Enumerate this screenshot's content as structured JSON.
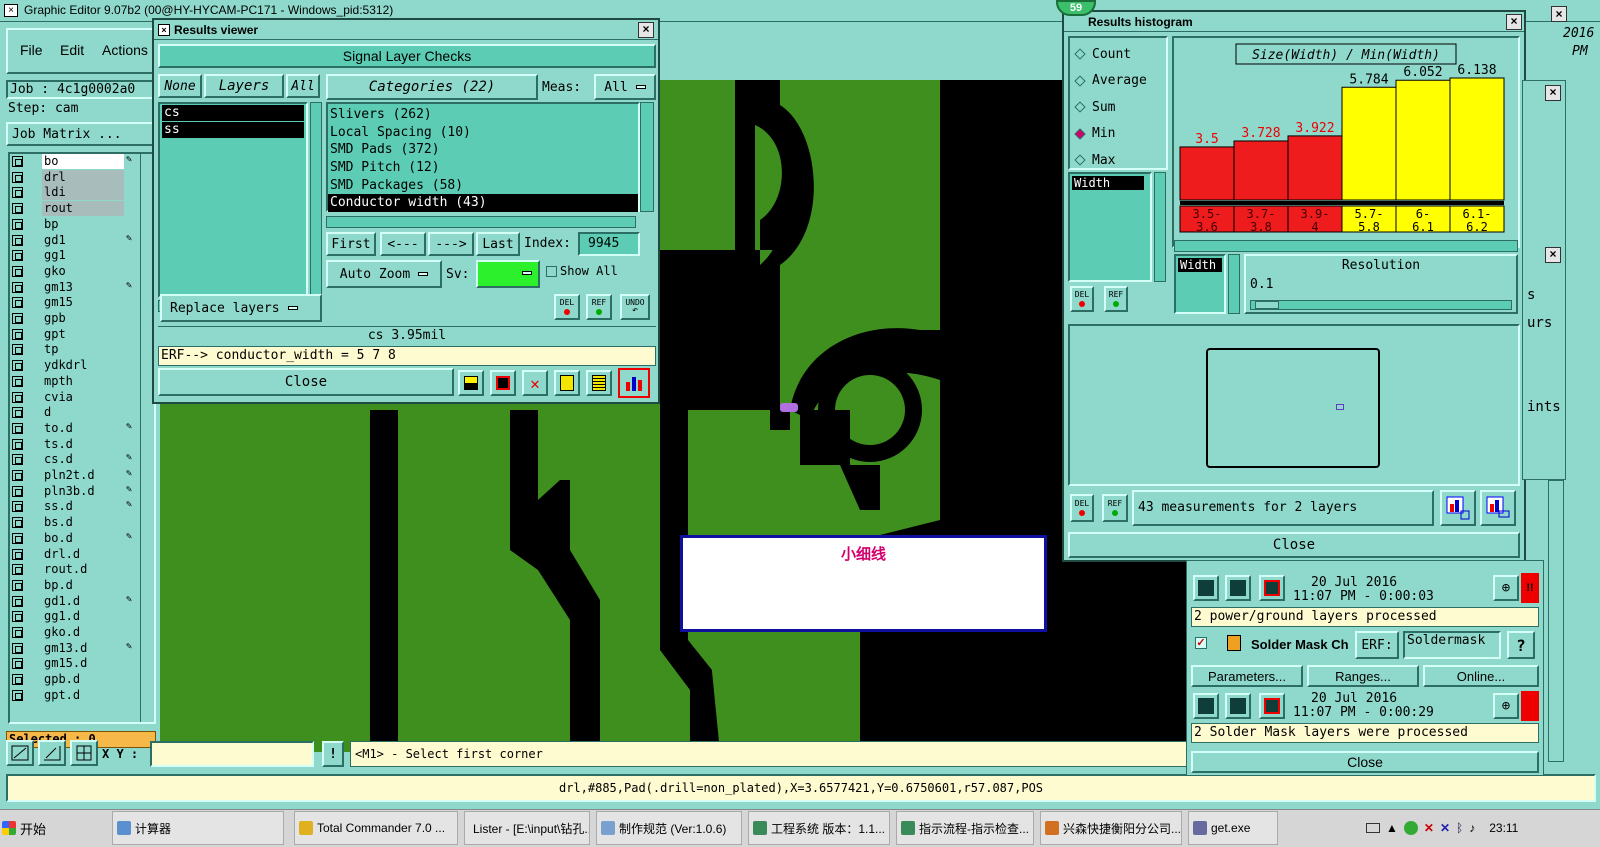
{
  "app": {
    "title": "Graphic Editor 9.07b2 (00@HY-HYCAM-PC171 - Windows_pid:5312)",
    "menu": [
      "File",
      "Edit",
      "Actions"
    ],
    "job": "Job : 4c1g0002a0",
    "step": "Step: cam",
    "job_matrix": "Job Matrix ...",
    "selected": "Selected : 0",
    "xy_label": "X Y :",
    "xy_value": "",
    "excl": "!",
    "prompt": "<M1> - Select first corner",
    "status": "drl,#885,Pad(.drill=non_plated),X=3.6577421,Y=0.6750601,r57.087,POS",
    "clock_top": "2016",
    "clock_pm": "PM",
    "layers": [
      {
        "name": "bo",
        "edit": true,
        "style": "white"
      },
      {
        "name": "drl",
        "edit": false,
        "style": "grey"
      },
      {
        "name": "ldi",
        "edit": false,
        "style": "grey"
      },
      {
        "name": "rout",
        "edit": false,
        "style": "grey"
      },
      {
        "name": "bp",
        "edit": false,
        "style": "plain"
      },
      {
        "name": "gd1",
        "edit": true,
        "style": "plain"
      },
      {
        "name": "gg1",
        "edit": false,
        "style": "plain"
      },
      {
        "name": "gko",
        "edit": false,
        "style": "plain"
      },
      {
        "name": "gm13",
        "edit": true,
        "style": "plain"
      },
      {
        "name": "gm15",
        "edit": false,
        "style": "plain"
      },
      {
        "name": "gpb",
        "edit": false,
        "style": "plain"
      },
      {
        "name": "gpt",
        "edit": false,
        "style": "plain"
      },
      {
        "name": "tp",
        "edit": false,
        "style": "plain"
      },
      {
        "name": "ydkdrl",
        "edit": false,
        "style": "plain"
      },
      {
        "name": "mpth",
        "edit": false,
        "style": "plain"
      },
      {
        "name": "cvia",
        "edit": false,
        "style": "plain"
      },
      {
        "name": "d",
        "edit": false,
        "style": "plain"
      },
      {
        "name": "to.d",
        "edit": true,
        "style": "plain"
      },
      {
        "name": "ts.d",
        "edit": false,
        "style": "plain"
      },
      {
        "name": "cs.d",
        "edit": true,
        "style": "plain"
      },
      {
        "name": "pln2t.d",
        "edit": true,
        "style": "plain"
      },
      {
        "name": "pln3b.d",
        "edit": true,
        "style": "plain"
      },
      {
        "name": "ss.d",
        "edit": true,
        "style": "plain"
      },
      {
        "name": "bs.d",
        "edit": false,
        "style": "plain"
      },
      {
        "name": "bo.d",
        "edit": true,
        "style": "plain"
      },
      {
        "name": "drl.d",
        "edit": false,
        "style": "plain"
      },
      {
        "name": "rout.d",
        "edit": false,
        "style": "plain"
      },
      {
        "name": "bp.d",
        "edit": false,
        "style": "plain"
      },
      {
        "name": "gd1.d",
        "edit": true,
        "style": "plain"
      },
      {
        "name": "gg1.d",
        "edit": false,
        "style": "plain"
      },
      {
        "name": "gko.d",
        "edit": false,
        "style": "plain"
      },
      {
        "name": "gm13.d",
        "edit": true,
        "style": "plain"
      },
      {
        "name": "gm15.d",
        "edit": false,
        "style": "plain"
      },
      {
        "name": "gpb.d",
        "edit": false,
        "style": "plain"
      },
      {
        "name": "gpt.d",
        "edit": false,
        "style": "plain"
      }
    ]
  },
  "results_viewer": {
    "title": "Results viewer",
    "heading": "Signal Layer Checks",
    "none": "None",
    "layers": "Layers",
    "all": "All",
    "layer_list": [
      "cs",
      "ss"
    ],
    "categories_label": "Categories (22)",
    "meas_label": "Meas:",
    "meas_value": "All",
    "categories": [
      "Slivers (262)",
      "Local Spacing (10)",
      "SMD Pads (372)",
      "SMD Pitch (12)",
      "SMD Packages (58)",
      "Conductor width (43)"
    ],
    "first": "First",
    "prev": "<---",
    "next": "--->",
    "last": "Last",
    "index_label": "Index:",
    "index_value": "9945",
    "auto_zoom": "Auto Zoom",
    "sv_label": "Sv:",
    "show_all": "Show All",
    "replace_layers": "Replace layers",
    "del": "DEL",
    "ref": "REF",
    "undo": "UNDO",
    "measure": "cs 3.95mil",
    "erf": "ERF--> conductor_width = 5 7 8",
    "close": "Close"
  },
  "histogram": {
    "title": "Results histogram",
    "badge": "59",
    "options": [
      {
        "label": "Count",
        "selected": false
      },
      {
        "label": "Average",
        "selected": false
      },
      {
        "label": "Sum",
        "selected": false
      },
      {
        "label": "Min",
        "selected": true
      },
      {
        "label": "Max",
        "selected": false
      }
    ],
    "field": "Width",
    "resolution_label": "Resolution",
    "resolution_value": "0.1",
    "width_tag": "Width",
    "del": "DEL",
    "ref": "REF",
    "summary": "43 measurements for 2 layers",
    "close": "Close"
  },
  "chart_data": {
    "type": "bar",
    "title": "Size(Width) / Min(Width)",
    "categories": [
      "3.5-3.6",
      "3.7-3.8",
      "3.9-4",
      "5.7-5.8",
      "6-6.1",
      "6.1-6.2"
    ],
    "values": [
      3.5,
      3.728,
      3.922,
      5.784,
      6.052,
      6.138
    ],
    "value_labels": [
      "3.5",
      "3.728",
      "3.922",
      "5.784",
      "6.052",
      "6.138"
    ],
    "colors": [
      "#ee1c1c",
      "#ee1c1c",
      "#ee1c1c",
      "#ffff00",
      "#ffff00",
      "#ffff00"
    ],
    "ylim": [
      0,
      6.138
    ]
  },
  "annotation": {
    "text": "小细线"
  },
  "checklist": {
    "row1_date": "20 Jul 2016",
    "row1_time": "11:07 PM - 0:00:03",
    "row1_msg": "2 power/ground layers processed",
    "sm_name": "Solder Mask Ch",
    "sm_erf": "ERF:",
    "sm_value": "Soldermask",
    "help": "?",
    "parameters": "Parameters...",
    "ranges": "Ranges...",
    "online": "Online...",
    "row2_date": "20 Jul 2016",
    "row2_time": "11:07 PM - 0:00:29",
    "row2_msg": "2 Solder Mask layers were processed",
    "close": "Close",
    "edge_labels": [
      "s",
      "urs",
      "ints"
    ],
    "bang": "!!"
  },
  "taskbar": {
    "start": "开始",
    "items": [
      "计算器",
      "Total Commander 7.0 ...",
      "Lister - [E:\\input\\钻孔....",
      "制作规范 (Ver:1.0.6)",
      "工程系统  版本：1.1...",
      "指示流程-指示检查...",
      "兴森快捷衡阳分公司...",
      "get.exe"
    ],
    "clock": "23:11"
  }
}
